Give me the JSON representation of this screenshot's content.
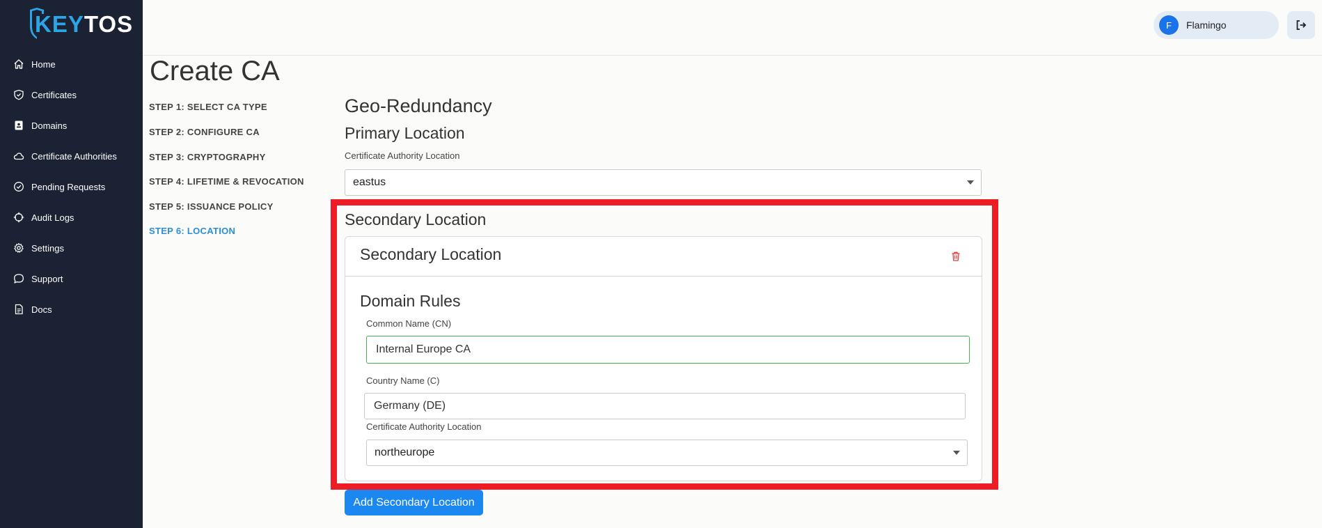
{
  "brand": {
    "logo_left": "KEY",
    "logo_right": "TOS",
    "accent": "#2aa6e8",
    "sidebar_bg": "#1a2234"
  },
  "sidebar": {
    "items": [
      {
        "label": "Home",
        "icon": "home-icon"
      },
      {
        "label": "Certificates",
        "icon": "shield-icon"
      },
      {
        "label": "Domains",
        "icon": "id-card-icon"
      },
      {
        "label": "Certificate Authorities",
        "icon": "cloud-icon"
      },
      {
        "label": "Pending Requests",
        "icon": "check-circle-icon"
      },
      {
        "label": "Audit Logs",
        "icon": "crosshair-icon"
      },
      {
        "label": "Settings",
        "icon": "gear-icon"
      },
      {
        "label": "Support",
        "icon": "chat-icon"
      },
      {
        "label": "Docs",
        "icon": "document-icon"
      }
    ]
  },
  "header": {
    "user_initial": "F",
    "user_name": "Flamingo",
    "logout_icon": "logout-icon"
  },
  "page": {
    "title": "Create CA"
  },
  "steps": [
    {
      "label": "STEP 1: SELECT CA TYPE",
      "active": false
    },
    {
      "label": "STEP 2: CONFIGURE CA",
      "active": false
    },
    {
      "label": "STEP 3: CRYPTOGRAPHY",
      "active": false
    },
    {
      "label": "STEP 4: LIFETIME & REVOCATION",
      "active": false
    },
    {
      "label": "STEP 5: ISSUANCE POLICY",
      "active": false
    },
    {
      "label": "STEP 6: LOCATION",
      "active": true
    }
  ],
  "form": {
    "heading": "Geo-Redundancy",
    "primary": {
      "heading": "Primary Location",
      "location_label": "Certificate Authority Location",
      "location_value": "eastus"
    },
    "secondary": {
      "heading": "Secondary Location",
      "card_title": "Secondary Location",
      "domain_rules_heading": "Domain Rules",
      "cn_label": "Common Name (CN)",
      "cn_value": "Internal Europe CA",
      "country_label": "Country Name (C)",
      "country_value": "Germany (DE)",
      "location_label": "Certificate Authority Location",
      "location_value": "northeurope"
    },
    "add_button_label": "Add Secondary Location"
  }
}
